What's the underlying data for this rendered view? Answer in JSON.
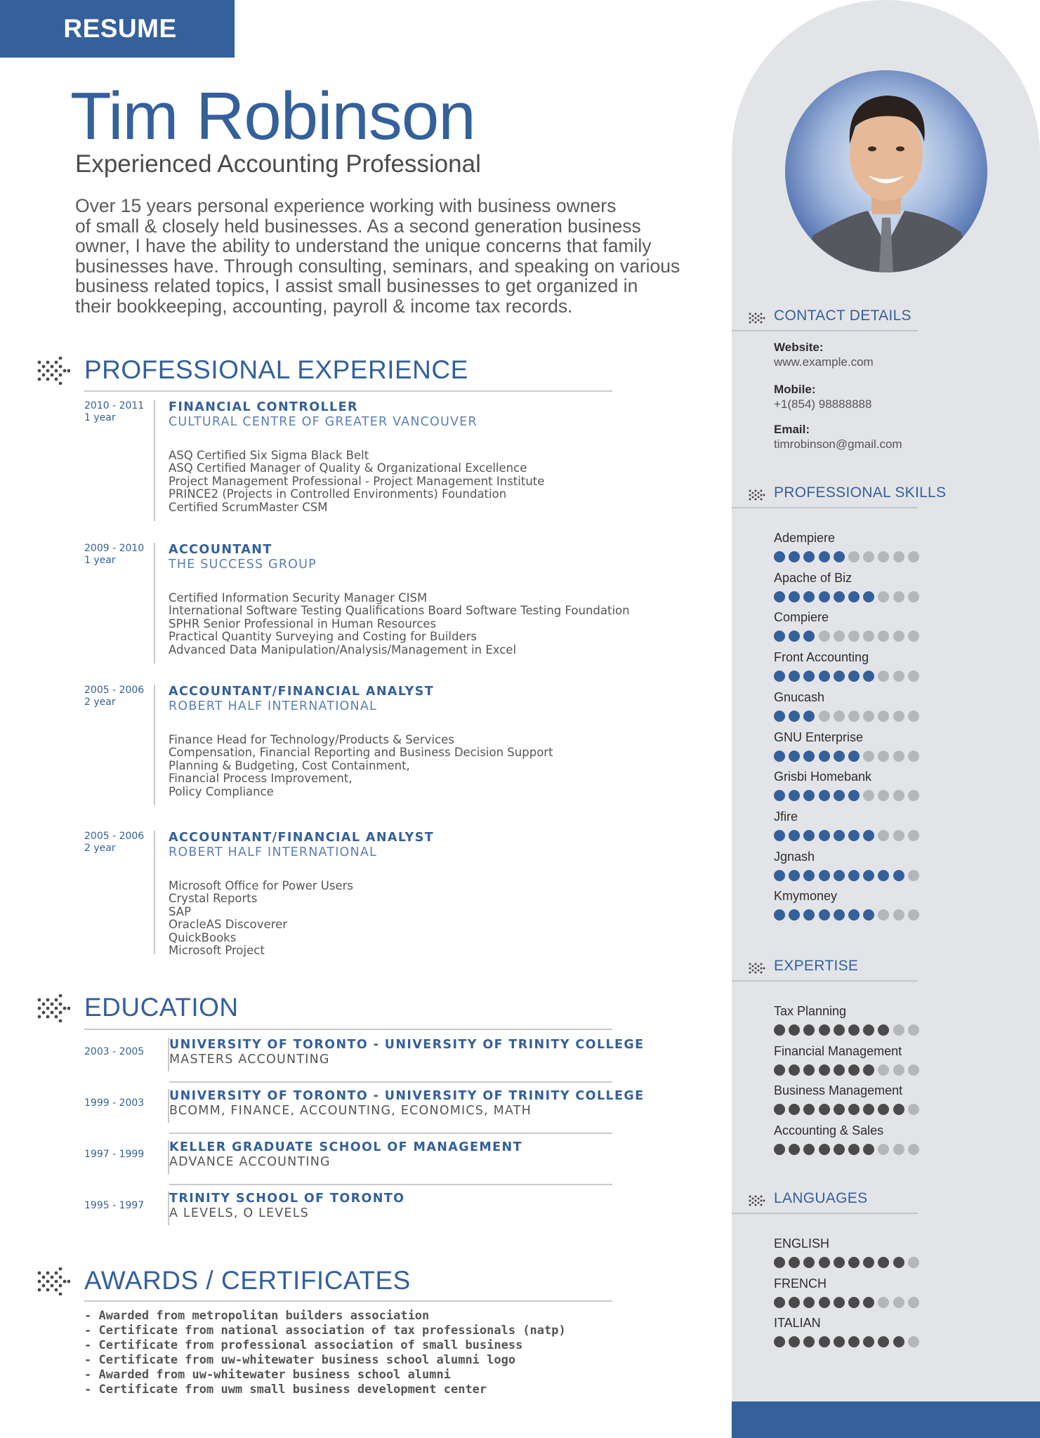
{
  "header": {
    "tag": "RESUME",
    "name": "Tim Robinson",
    "title": "Experienced Accounting Professional",
    "summary_lines": [
      "Over 15 years personal experience working with business owners",
      "of small & closely held businesses. As a second generation business",
      "owner, I have the ability to understand the unique concerns that family",
      "businesses have. Through consulting, seminars, and speaking on various",
      "business related topics, I assist small businesses to get organized in",
      "their bookkeeping, accounting, payroll & income tax records."
    ]
  },
  "experience": {
    "heading": "PROFESSIONAL EXPERIENCE",
    "jobs": [
      {
        "years": "2010 - 2011",
        "duration": "1 year",
        "title": "FINANCIAL CONTROLLER",
        "company": "CULTURAL CENTRE OF GREATER VANCOUVER",
        "items": [
          "ASQ Certified Six Sigma Black Belt",
          "ASQ Certified Manager of Quality & Organizational Excellence",
          "Project Management Professional - Project Management Institute",
          "PRINCE2 (Projects in Controlled Environments) Foundation",
          "Certified ScrumMaster CSM"
        ]
      },
      {
        "years": "2009 - 2010",
        "duration": "1 year",
        "title": "ACCOUNTANT",
        "company": "THE SUCCESS GROUP",
        "items": [
          "Certified Information Security Manager CISM",
          "International Software Testing Qualifications Board Software Testing Foundation",
          "SPHR Senior Professional in Human Resources",
          "Practical Quantity Surveying and Costing for Builders",
          "Advanced Data Manipulation/Analysis/Management in Excel"
        ]
      },
      {
        "years": "2005 - 2006",
        "duration": "2 year",
        "title": "ACCOUNTANT/FINANCIAL ANALYST",
        "company": "ROBERT HALF INTERNATIONAL",
        "items": [
          "Finance Head for Technology/Products & Services",
          "Compensation, Financial Reporting and Business Decision Support",
          "Planning & Budgeting, Cost Containment,",
          "Financial Process Improvement,",
          "Policy Compliance"
        ]
      },
      {
        "years": "2005 - 2006",
        "duration": "2 year",
        "title": "ACCOUNTANT/FINANCIAL ANALYST",
        "company": "ROBERT HALF INTERNATIONAL",
        "items": [
          "Microsoft Office for Power Users",
          "Crystal Reports",
          "SAP",
          "OracleAS Discoverer",
          "QuickBooks",
          "Microsoft Project"
        ]
      }
    ]
  },
  "education": {
    "heading": "EDUCATION",
    "entries": [
      {
        "years": "2003 - 2005",
        "school": "UNIVERSITY OF TORONTO - UNIVERSITY OF TRINITY COLLEGE",
        "degree": "MASTERS ACCOUNTING"
      },
      {
        "years": "1999 - 2003",
        "school": "UNIVERSITY OF TORONTO - UNIVERSITY OF TRINITY COLLEGE",
        "degree": "BCOMM, FINANCE, ACCOUNTING, ECONOMICS, MATH"
      },
      {
        "years": "1997 - 1999",
        "school": "KELLER GRADUATE SCHOOL OF MANAGEMENT",
        "degree": "ADVANCE ACCOUNTING"
      },
      {
        "years": "1995 - 1997",
        "school": "TRINITY SCHOOL OF TORONTO",
        "degree": "A LEVELS, O LEVELS"
      }
    ]
  },
  "awards": {
    "heading": "AWARDS / CERTIFICATES",
    "items": [
      "- Awarded from metropolitan builders association",
      "- Certificate from national association of tax professionals (natp)",
      "- Certificate from professional association of small business",
      "- Certificate from uw-whitewater business school alumni logo",
      "- Awarded from uw-whitewater business school alumni",
      "- Certificate from uwm small business development center"
    ]
  },
  "contact": {
    "heading": "CONTACT DETAILS",
    "website_label": "Website:",
    "website": "www.example.com",
    "mobile_label": "Mobile:",
    "mobile": "+1(854) 98888888",
    "email_label": "Email:",
    "email": "timrobinson@gmail.com"
  },
  "skills": {
    "heading": "PROFESSIONAL SKILLS",
    "max": 10,
    "items": [
      {
        "name": "Adempiere",
        "level": 5
      },
      {
        "name": "Apache of Biz",
        "level": 7
      },
      {
        "name": "Compiere",
        "level": 3
      },
      {
        "name": "Front Accounting",
        "level": 7
      },
      {
        "name": "Gnucash",
        "level": 3
      },
      {
        "name": "GNU Enterprise",
        "level": 6
      },
      {
        "name": "Grisbi Homebank",
        "level": 6
      },
      {
        "name": "Jfire",
        "level": 7
      },
      {
        "name": "Jgnash",
        "level": 9
      },
      {
        "name": "Kmymoney",
        "level": 7
      }
    ]
  },
  "expertise": {
    "heading": "EXPERTISE",
    "max": 10,
    "items": [
      {
        "name": "Tax Planning",
        "level": 8
      },
      {
        "name": "Financial Management",
        "level": 7
      },
      {
        "name": "Business Management",
        "level": 9
      },
      {
        "name": "Accounting & Sales",
        "level": 7
      }
    ]
  },
  "languages": {
    "heading": "LANGUAGES",
    "max": 10,
    "items": [
      {
        "name": "ENGLISH",
        "level": 9
      },
      {
        "name": "FRENCH",
        "level": 7
      },
      {
        "name": "ITALIAN",
        "level": 9
      }
    ]
  },
  "colors": {
    "accent": "#34609b",
    "sidebar": "#e3e4e8",
    "dot_off": "#b5b6ba",
    "dot_dark": "#4a4a4a"
  }
}
